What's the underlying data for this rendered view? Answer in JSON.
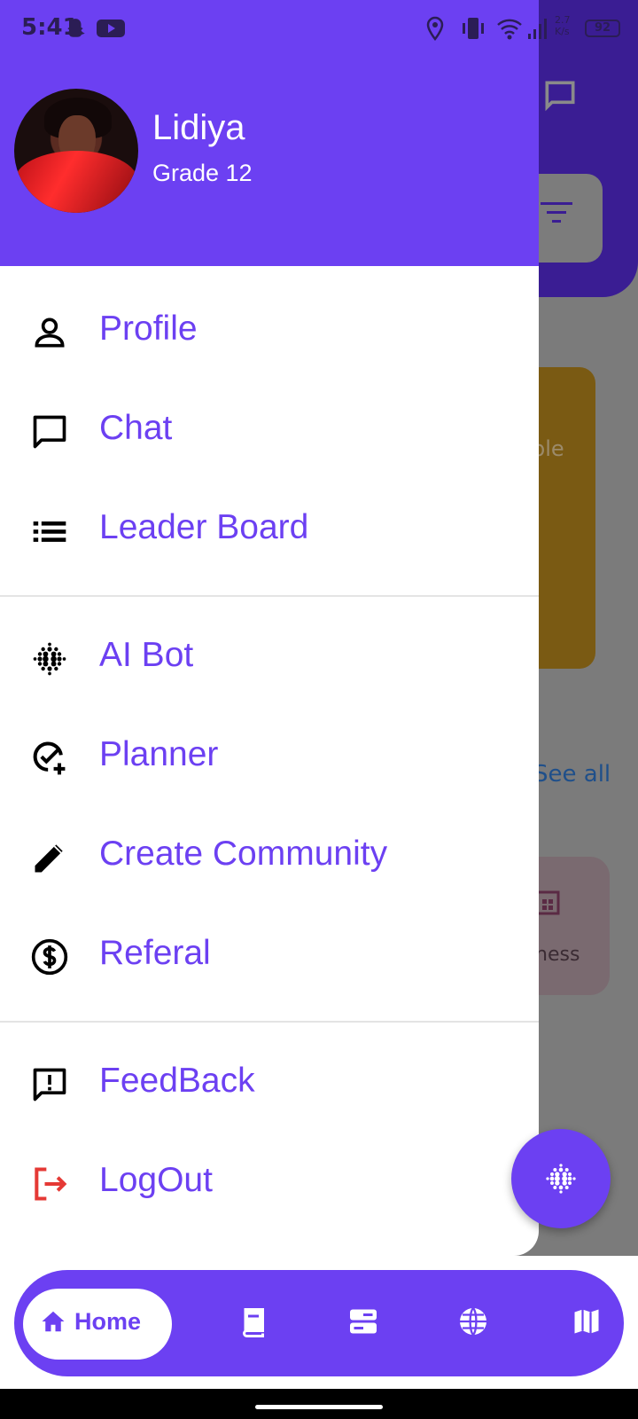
{
  "status_bar": {
    "time": "5:41",
    "icons": [
      "snapchat-icon",
      "youtube-icon",
      "location-icon",
      "vibrate-icon",
      "wifi-icon",
      "signal-icon",
      "battery-icon"
    ],
    "net_speed": "2.7 K/s",
    "battery": "92"
  },
  "background": {
    "yellow_card_text": "ple",
    "see_all": "See all",
    "card_text": "ness"
  },
  "drawer": {
    "user": {
      "name": "Lidiya",
      "grade": "Grade 12"
    },
    "items": [
      {
        "label": "Profile",
        "icon": "person-icon"
      },
      {
        "label": "Chat",
        "icon": "chat-icon"
      },
      {
        "label": "Leader Board",
        "icon": "list-icon"
      },
      {
        "label": "AI Bot",
        "icon": "ai-bot-icon"
      },
      {
        "label": "Planner",
        "icon": "planner-icon"
      },
      {
        "label": "Create Community",
        "icon": "pencil-icon"
      },
      {
        "label": "Referal",
        "icon": "dollar-icon"
      },
      {
        "label": "FeedBack",
        "icon": "feedback-icon"
      },
      {
        "label": "LogOut",
        "icon": "logout-icon"
      }
    ]
  },
  "bottom_nav": {
    "home_label": "Home",
    "items": [
      "home-icon",
      "book-icon",
      "storage-icon",
      "globe-icon",
      "map-icon"
    ]
  },
  "colors": {
    "primary": "#6c40f2",
    "logout_red": "#e53935",
    "white": "#ffffff"
  }
}
